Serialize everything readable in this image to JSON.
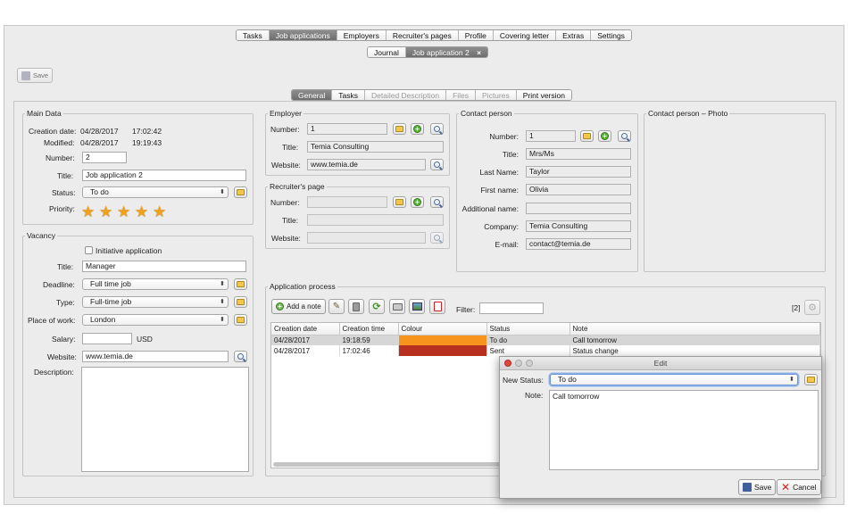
{
  "top_tabs": [
    "Tasks",
    "Job applications",
    "Employers",
    "Recruiter's pages",
    "Profile",
    "Covering letter",
    "Extras",
    "Settings"
  ],
  "top_tabs_active": 1,
  "doc_tabs": {
    "journal": "Journal",
    "current": "Job application 2",
    "close": "×"
  },
  "toolbar": {
    "save": "Save"
  },
  "sub_tabs": [
    "General",
    "Tasks",
    "Detailed Description",
    "Files",
    "Pictures",
    "Print version"
  ],
  "sub_tabs_active": 0,
  "main_data": {
    "title": "Main Data",
    "creation_date_label": "Creation date:",
    "creation_date": "04/28/2017",
    "creation_time": "17:02:42",
    "modified_label": "Modified:",
    "modified_date": "04/28/2017",
    "modified_time": "19:19:43",
    "number_label": "Number:",
    "number": "2",
    "title_label": "Title:",
    "title_value": "Job application 2",
    "status_label": "Status:",
    "status": "To do",
    "priority_label": "Priority:",
    "priority_stars": 5
  },
  "vacancy": {
    "title": "Vacancy",
    "initiative": "Initiative application",
    "title_label": "Title:",
    "title_value": "Manager",
    "deadline_label": "Deadline:",
    "deadline": "Full time job",
    "type_label": "Type:",
    "type": "Full-time job",
    "place_label": "Place of work:",
    "place": "London",
    "salary_label": "Salary:",
    "salary": "",
    "currency": "USD",
    "website_label": "Website:",
    "website": "www.temia.de",
    "description_label": "Description:"
  },
  "employer": {
    "title": "Employer",
    "number_label": "Number:",
    "number": "1",
    "title_label": "Title:",
    "title_value": "Temia Consulting",
    "website_label": "Website:",
    "website": "www.temia.de"
  },
  "recruiter": {
    "title": "Recruiter's page",
    "number_label": "Number:",
    "title_label": "Title:",
    "website_label": "Website:"
  },
  "contact": {
    "title": "Contact person",
    "number_label": "Number:",
    "number": "1",
    "title_label": "Title:",
    "title_value": "Mrs/Ms",
    "last_name_label": "Last Name:",
    "last_name": "Taylor",
    "first_name_label": "First name:",
    "first_name": "Olivia",
    "additional_label": "Additional name:",
    "additional": "",
    "company_label": "Company:",
    "company": "Temia Consulting",
    "email_label": "E-mail:",
    "email": "contact@temia.de"
  },
  "photo": {
    "title": "Contact person – Photo"
  },
  "process": {
    "title": "Application process",
    "add_note": "Add a note",
    "filter_label": "Filter:",
    "count": "[2]",
    "columns": [
      "Creation date",
      "Creation time",
      "Colour",
      "Status",
      "Note"
    ],
    "rows": [
      {
        "date": "04/28/2017",
        "time": "19:18:59",
        "colour": "#f7941d",
        "status": "To do",
        "note": "Call tomorrow"
      },
      {
        "date": "04/28/2017",
        "time": "17:02:46",
        "colour": "#b8301f",
        "status": "Sent",
        "note": "Status change"
      }
    ]
  },
  "dialog": {
    "title": "Edit",
    "status_label": "New Status:",
    "status": "To do",
    "note_label": "Note:",
    "note": "Call tomorrow",
    "save": "Save",
    "cancel": "Cancel"
  }
}
